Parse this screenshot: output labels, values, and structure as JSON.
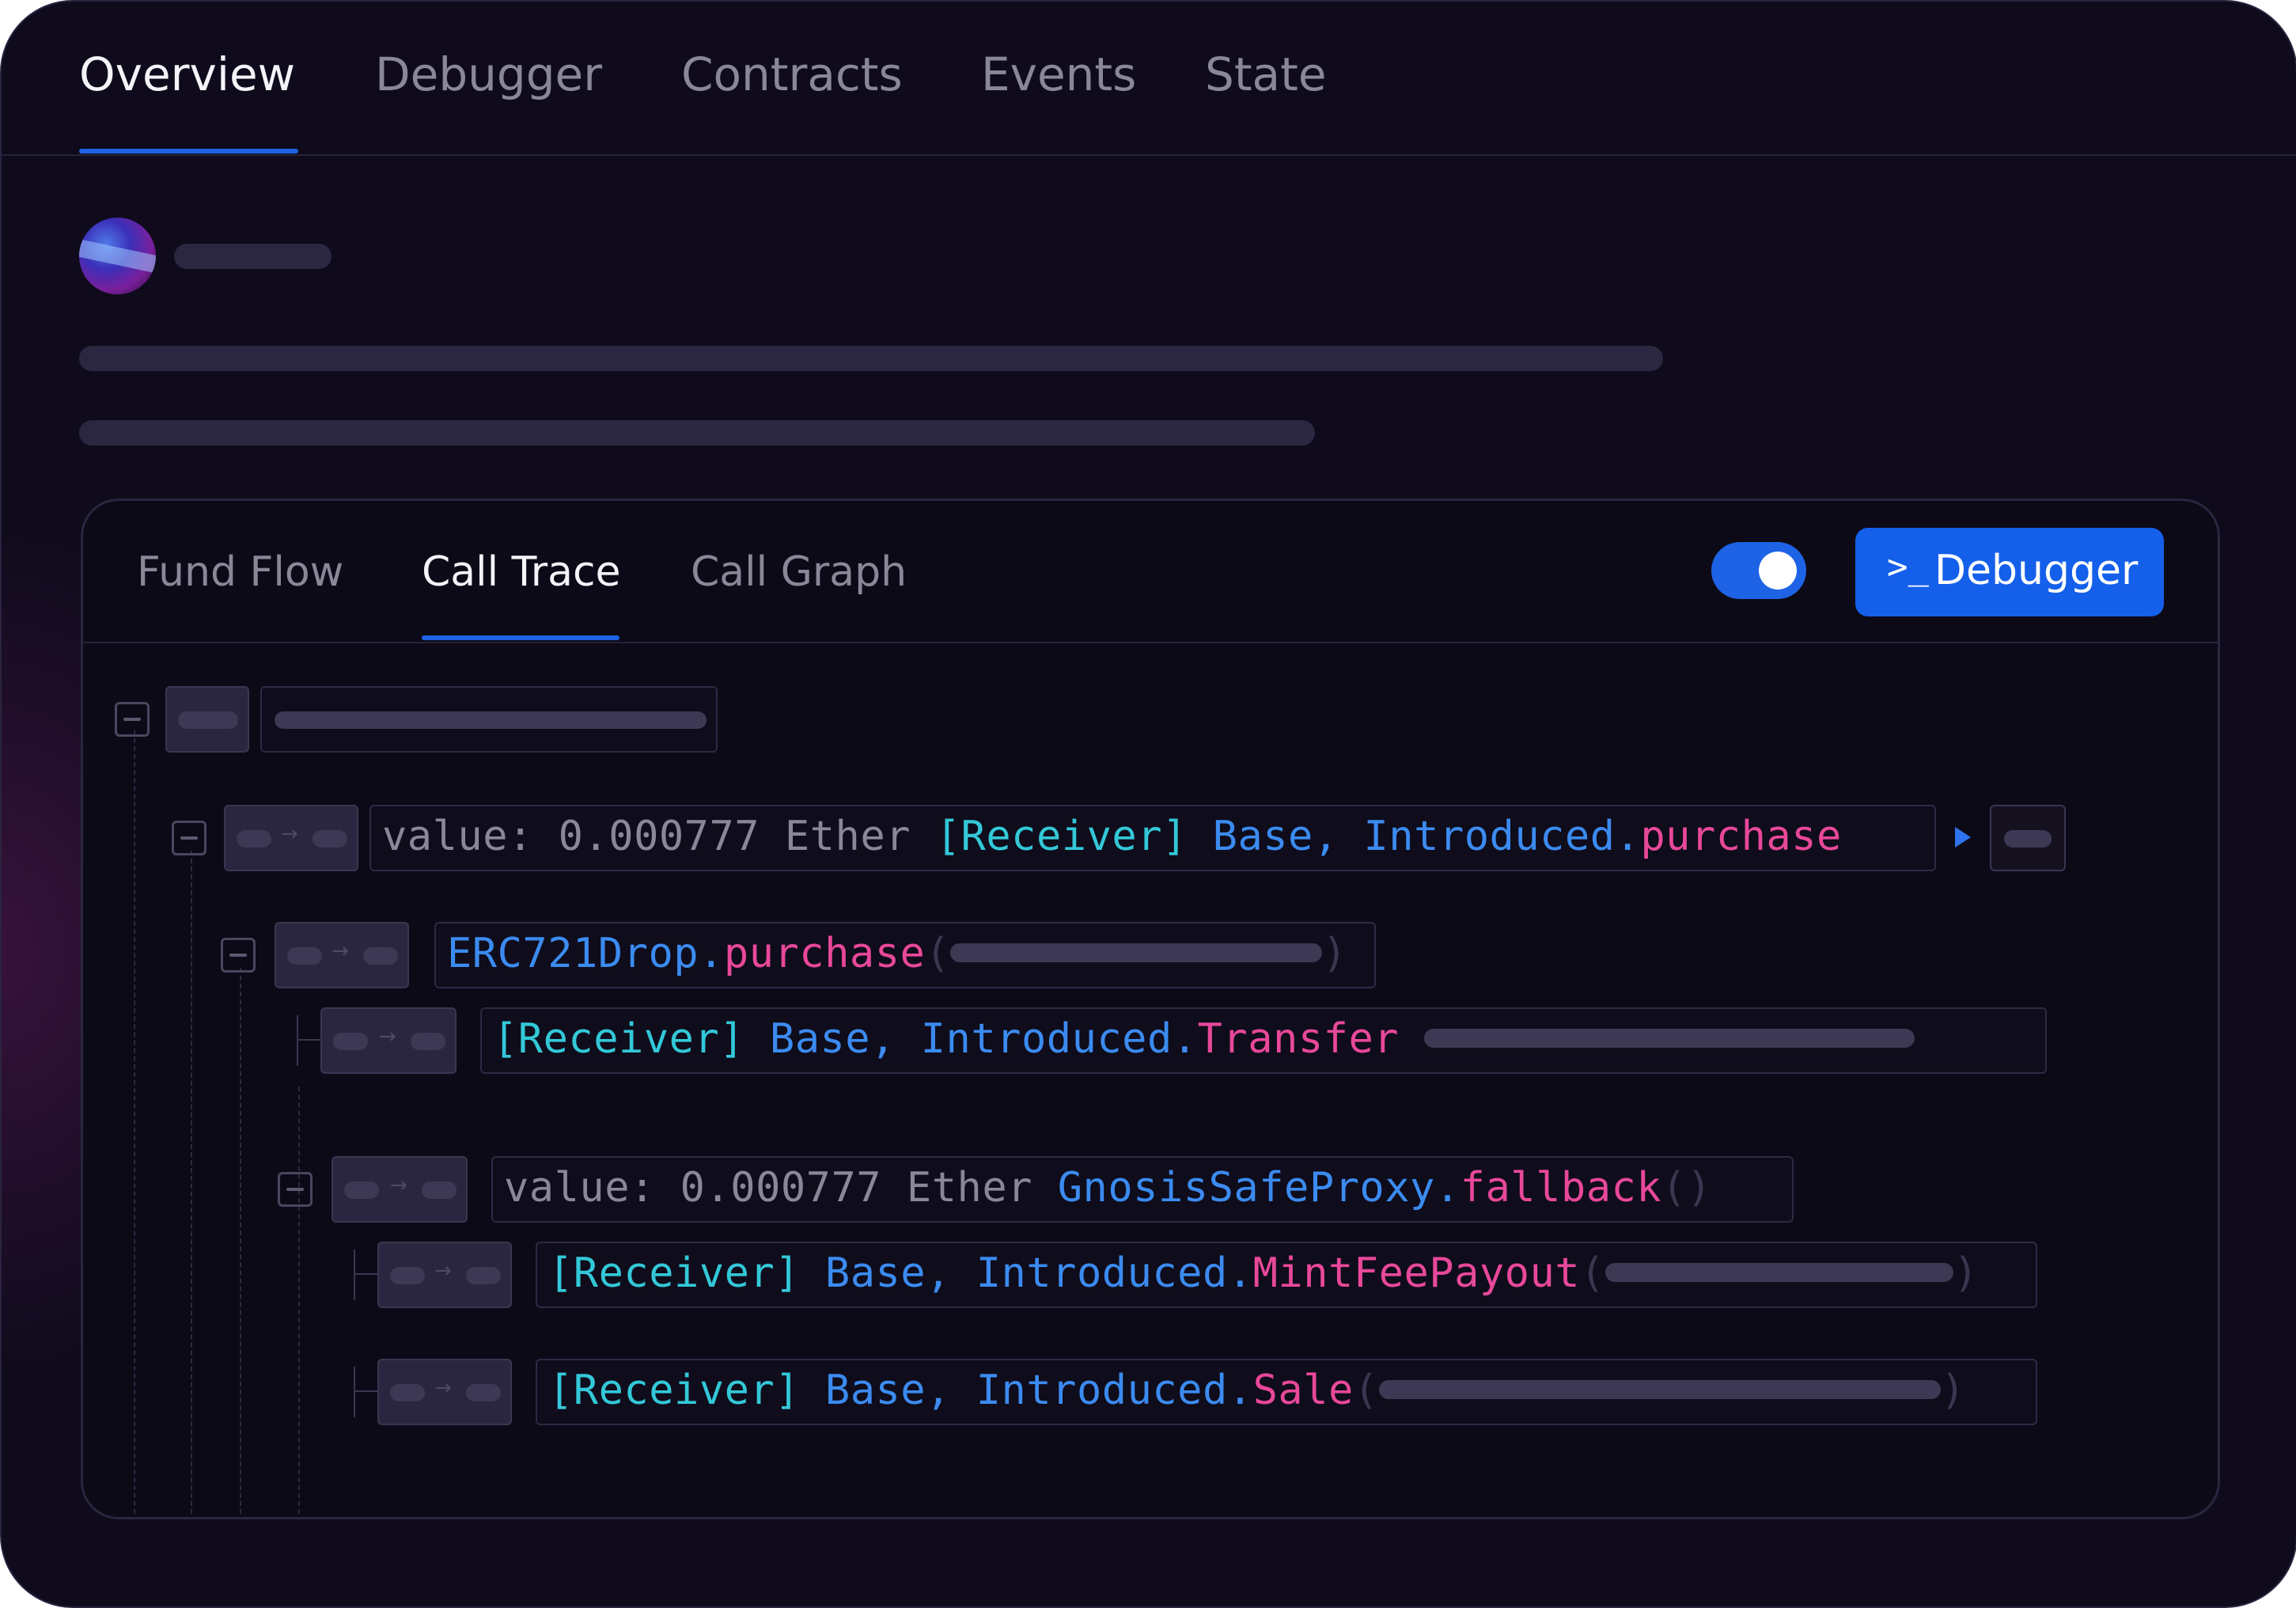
{
  "top_tabs": [
    "Overview",
    "Debugger",
    "Contracts",
    "Events",
    "State"
  ],
  "active_top_tab": "Overview",
  "panel": {
    "tabs": [
      "Fund Flow",
      "Call Trace",
      "Call Graph"
    ],
    "active_tab": "Call Trace",
    "toggle_on": true,
    "debugger_button": {
      "icon": ">_",
      "label": "Debugger"
    }
  },
  "trace": {
    "row1": {
      "value_text": "value: 0.000777 Ether ",
      "receiver": "[Receiver]",
      "contract": " Base, Introduced",
      "dot": ".",
      "method": "purchase"
    },
    "row2": {
      "contract": "ERC721Drop",
      "dot": ".",
      "method": "purchase",
      "open": "(",
      "close": ")"
    },
    "row3": {
      "receiver": "[Receiver]",
      "contract": " Base, Introduced",
      "dot": ".",
      "method": "Transfer"
    },
    "row4": {
      "value_text": "value: 0.000777 Ether ",
      "contract": "GnosisSafeProxy",
      "dot": ".",
      "method": "fallback",
      "parens": "()"
    },
    "row5": {
      "receiver": "[Receiver]",
      "contract": " Base, Introduced",
      "dot": ".",
      "method": "MintFeePayout",
      "open": "(",
      "close": ")"
    },
    "row6": {
      "receiver": "[Receiver]",
      "contract": " Base, Introduced",
      "dot": ".",
      "method": "Sale",
      "open": "(",
      "close": ")"
    }
  },
  "icons": [
    "collapse-icon",
    "arrow-right-icon",
    "play-icon",
    "terminal-icon"
  ],
  "colors": {
    "accent": "#1e63e6",
    "receiver": "#33c8d8",
    "contract": "#3b8bf0",
    "method": "#e8489a"
  }
}
